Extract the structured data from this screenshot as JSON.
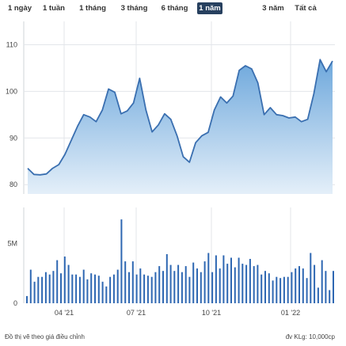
{
  "range_tabs": [
    {
      "label": "1 ngày",
      "active": false
    },
    {
      "label": "1 tuần",
      "active": false
    },
    {
      "label": "1 tháng",
      "active": false
    },
    {
      "label": "3 tháng",
      "active": false
    },
    {
      "label": "6 tháng",
      "active": false
    },
    {
      "label": "1 năm",
      "active": true
    },
    {
      "label": "3 năm",
      "active": false
    },
    {
      "label": "Tất cả",
      "active": false
    }
  ],
  "footer": {
    "note": "Đồ thị vẽ theo giá điều chỉnh",
    "unit": "đv KLg: 10,000cp"
  },
  "colors": {
    "line": "#3a6fb0",
    "area_top": "#6ea8dc",
    "area_bottom": "#e4eff9",
    "bar": "#2e67b2",
    "active_tab": "#27405f",
    "grid": "#e3e6ea"
  },
  "chart_data": [
    {
      "type": "area",
      "x_tick_labels": [
        "04 '21",
        "07 '21",
        "10 '21",
        "01 '22"
      ],
      "yticks": [
        80,
        90,
        100,
        110
      ],
      "ylim": [
        78,
        115
      ],
      "grid": true,
      "values": [
        83.5,
        82.2,
        82.1,
        82.3,
        83.5,
        84.3,
        86.5,
        89.5,
        92.5,
        95.0,
        94.5,
        93.5,
        96.0,
        100.5,
        99.8,
        95.2,
        95.8,
        97.5,
        102.8,
        96.0,
        91.3,
        92.8,
        95.2,
        94.0,
        90.5,
        86.0,
        84.8,
        89.0,
        90.5,
        91.2,
        96.0,
        98.8,
        97.5,
        99.0,
        104.5,
        105.5,
        104.8,
        101.8,
        95.0,
        96.5,
        95.0,
        94.8,
        94.3,
        94.5,
        93.5,
        94.0,
        99.5,
        106.8,
        104.2,
        106.5
      ]
    },
    {
      "type": "bar",
      "ylabel": "",
      "yticks_labels": [
        "0",
        "5M"
      ],
      "ytick_values": [
        0,
        5
      ],
      "ylim": [
        0,
        8
      ],
      "values": [
        0.6,
        2.8,
        1.8,
        2.2,
        2.2,
        2.6,
        2.4,
        2.7,
        3.6,
        2.5,
        3.9,
        3.2,
        2.4,
        2.4,
        2.2,
        2.8,
        2.0,
        2.5,
        2.4,
        2.3,
        1.8,
        1.4,
        2.2,
        2.4,
        2.8,
        7.0,
        3.5,
        2.6,
        3.5,
        2.4,
        2.9,
        2.4,
        2.3,
        2.2,
        2.6,
        3.1,
        2.7,
        4.1,
        3.2,
        2.7,
        3.2,
        2.6,
        3.1,
        2.2,
        3.4,
        2.9,
        2.6,
        3.5,
        4.2,
        2.6,
        4.0,
        2.9,
        4.0,
        3.3,
        3.8,
        3.0,
        3.8,
        3.3,
        3.2,
        3.7,
        3.1,
        3.2,
        2.4,
        2.7,
        2.5,
        1.9,
        2.2,
        2.1,
        2.2,
        2.2,
        2.6,
        2.9,
        3.1,
        2.9,
        2.1,
        4.2,
        3.2,
        1.3,
        3.6,
        2.7,
        1.1,
        2.7
      ]
    }
  ]
}
